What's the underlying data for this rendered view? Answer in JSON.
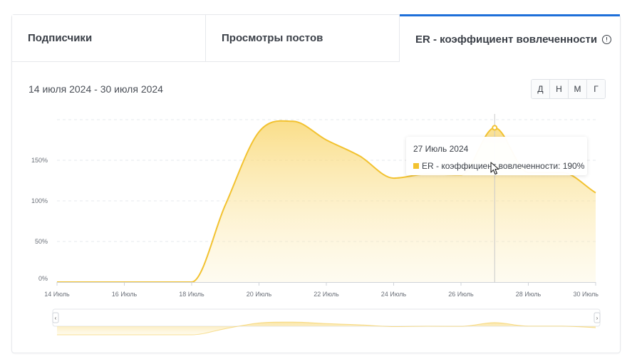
{
  "tabs": [
    {
      "label": "Подписчики",
      "active": false
    },
    {
      "label": "Просмотры постов",
      "active": false
    },
    {
      "label": "ER - коэффициент вовлеченности",
      "active": true
    }
  ],
  "date_range": "14 июля 2024 - 30 июля 2024",
  "period_buttons": [
    "Д",
    "Н",
    "М",
    "Г"
  ],
  "tooltip": {
    "date": "27 Июль 2024",
    "series_label": "ER - коэффициент вовлеченности:",
    "value": "190%"
  },
  "colors": {
    "series": "#f2c230",
    "active_tab": "#1e6fd9"
  },
  "chart_data": {
    "type": "area",
    "title": "",
    "xlabel": "",
    "ylabel": "",
    "ylim": [
      0,
      200
    ],
    "y_ticks": [
      {
        "value": 0,
        "label": "0%"
      },
      {
        "value": 50,
        "label": "50%"
      },
      {
        "value": 100,
        "label": "100%"
      },
      {
        "value": 150,
        "label": "150%"
      }
    ],
    "x_ticks": [
      {
        "value": 0,
        "label": "14 Июль"
      },
      {
        "value": 2,
        "label": "16 Июль"
      },
      {
        "value": 4,
        "label": "18 Июль"
      },
      {
        "value": 6,
        "label": "20 Июль"
      },
      {
        "value": 8,
        "label": "22 Июль"
      },
      {
        "value": 10,
        "label": "24 Июль"
      },
      {
        "value": 12,
        "label": "26 Июль"
      },
      {
        "value": 14,
        "label": "28 Июль"
      },
      {
        "value": 16,
        "label": "30 Июль"
      }
    ],
    "x": [
      "14 Июль",
      "15 Июль",
      "16 Июль",
      "17 Июль",
      "18 Июль",
      "19 Июль",
      "20 Июль",
      "21 Июль",
      "22 Июль",
      "23 Июль",
      "24 Июль",
      "25 Июль",
      "26 Июль",
      "27 Июль",
      "28 Июль",
      "29 Июль",
      "30 Июль"
    ],
    "series": [
      {
        "values": [
          0,
          0,
          0,
          0,
          0,
          95,
          185,
          198,
          175,
          155,
          128,
          133,
          132,
          190,
          135,
          135,
          110
        ]
      }
    ],
    "grid": true,
    "crosshair_index": 13,
    "navigator": true
  }
}
